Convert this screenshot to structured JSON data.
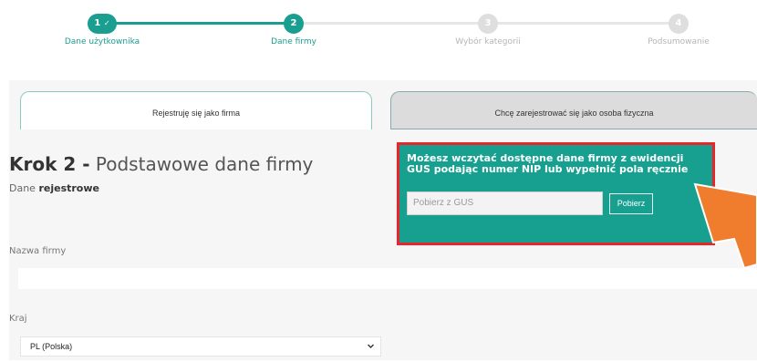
{
  "stepper": {
    "steps": [
      {
        "number": "1",
        "check": "✓",
        "label": "Dane użytkownika",
        "state": "done"
      },
      {
        "number": "2",
        "label": "Dane firmy",
        "state": "active"
      },
      {
        "number": "3",
        "label": "Wybór kategorii",
        "state": "todo"
      },
      {
        "number": "4",
        "label": "Podsumowanie",
        "state": "todo"
      }
    ]
  },
  "tabs": {
    "company": "Rejestruję się jako firma",
    "person": "Chcę zarejestrować się jako osoba fizyczna"
  },
  "heading": {
    "step": "Krok 2 -",
    "title": "Podstawowe dane firmy",
    "sub_prefix": "Dane",
    "sub_bold": "rejestrowe"
  },
  "gus": {
    "text": "Możesz wczytać dostępne dane firmy z ewidencji GUS podając numer NIP lub wypełnić pola ręcznie",
    "placeholder": "Pobierz z GUS",
    "button": "Pobierz"
  },
  "form": {
    "name_label": "Nazwa firmy",
    "country_label": "Kraj",
    "country_value": "PL (Polska)"
  },
  "colors": {
    "accent": "#1a9e8f",
    "highlight_border": "#e8262a",
    "arrow": "#f07d2e"
  },
  "icons": {
    "check": "check-icon",
    "dropdown": "chevron-down-icon"
  }
}
